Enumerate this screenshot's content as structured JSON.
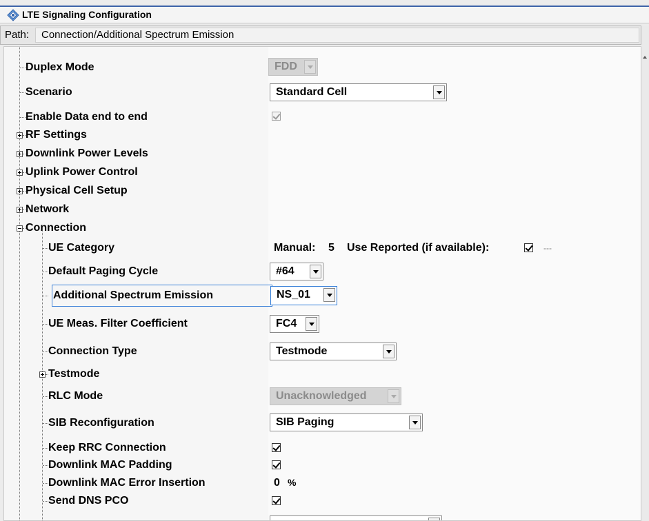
{
  "window": {
    "title": "LTE Signaling Configuration"
  },
  "path": {
    "label": "Path:",
    "value": "Connection/Additional Spectrum Emission"
  },
  "rows": {
    "duplex_mode": {
      "label": "Duplex Mode",
      "value": "FDD"
    },
    "scenario": {
      "label": "Scenario",
      "value": "Standard Cell"
    },
    "enable_data": {
      "label": "Enable Data end to end",
      "checked": true
    },
    "rf_settings": {
      "label": "RF Settings"
    },
    "downlink_power": {
      "label": "Downlink Power Levels"
    },
    "uplink_power": {
      "label": "Uplink Power Control"
    },
    "physical_cell": {
      "label": "Physical Cell Setup"
    },
    "network": {
      "label": "Network"
    },
    "connection": {
      "label": "Connection"
    },
    "ue_category": {
      "label": "UE Category",
      "manual_label": "Manual:",
      "manual_value": "5",
      "reported_label": "Use Reported (if available):",
      "reported_checked": true,
      "reported_value": "---"
    },
    "paging_cycle": {
      "label": "Default Paging Cycle",
      "value": "#64"
    },
    "spectrum_emission": {
      "label": "Additional Spectrum Emission",
      "value": "NS_01"
    },
    "filter_coeff": {
      "label": "UE Meas. Filter Coefficient",
      "value": "FC4"
    },
    "connection_type": {
      "label": "Connection Type",
      "value": "Testmode"
    },
    "testmode": {
      "label": "Testmode"
    },
    "rlc_mode": {
      "label": "RLC Mode",
      "value": "Unacknowledged"
    },
    "sib_reconfig": {
      "label": "SIB Reconfiguration",
      "value": "SIB Paging"
    },
    "keep_rrc": {
      "label": "Keep RRC Connection",
      "checked": true
    },
    "mac_padding": {
      "label": "Downlink MAC Padding",
      "checked": true
    },
    "mac_error": {
      "label": "Downlink MAC Error Insertion",
      "value": "0",
      "unit": "%"
    },
    "send_dns": {
      "label": "Send DNS PCO",
      "checked": true
    }
  }
}
